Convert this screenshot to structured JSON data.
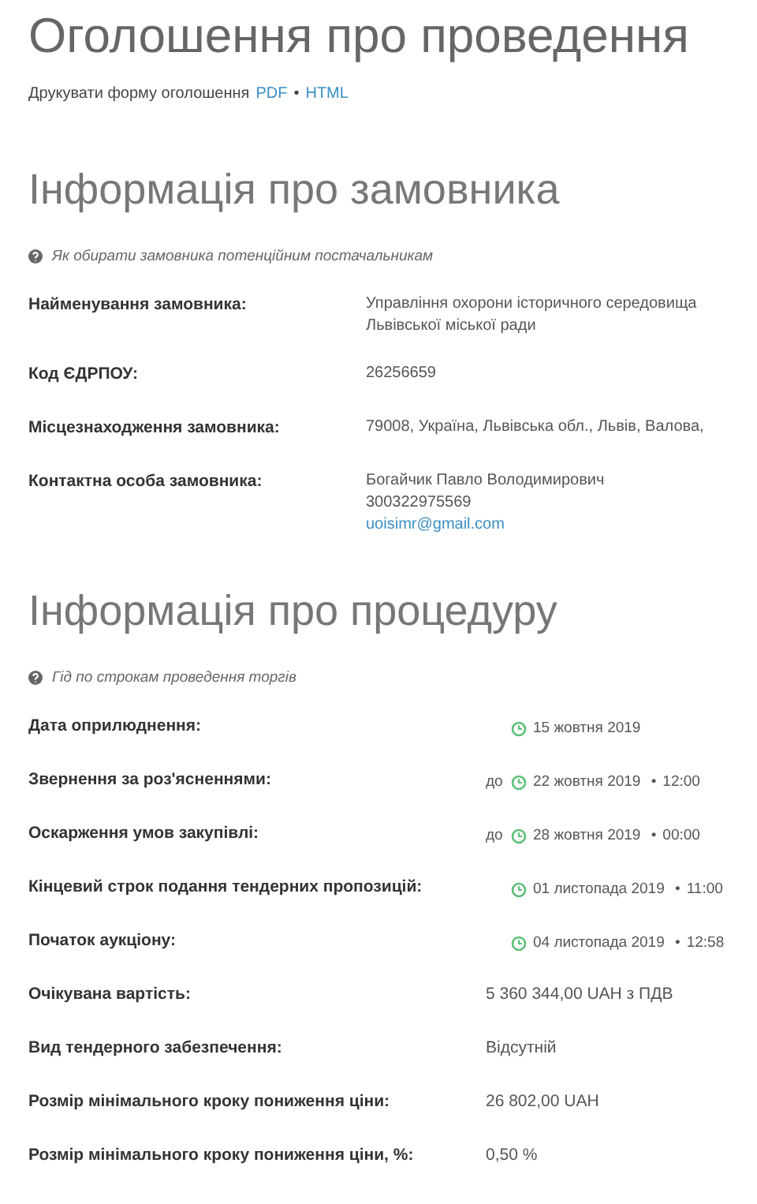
{
  "title": "Оголошення про проведення",
  "print": {
    "text": "Друкувати форму оголошення",
    "links": [
      "PDF",
      "HTML"
    ],
    "separator": "•"
  },
  "customer": {
    "heading": "Інформація про замовника",
    "hint": "Як обирати замовника потенційним постачальникам",
    "rows": [
      {
        "label": "Найменування замовника:",
        "lines": [
          "Управління охорони історичного середовища",
          "Львівської міської ради"
        ]
      },
      {
        "label": "Код ЄДРПОУ:",
        "lines": [
          "26256659"
        ]
      },
      {
        "label": "Місцезнаходження замовника:",
        "lines": [
          "79008, Україна, Львівська обл., Львів, Валова,"
        ]
      },
      {
        "label": "Контактна особа замовника:",
        "lines": [
          "Богайчик Павло Володимирович",
          "300322975569"
        ],
        "email": "uoisimr@gmail.com"
      }
    ]
  },
  "procedure": {
    "heading": "Інформація про процедуру",
    "hint": "Гід по строкам проведення торгів",
    "time_separator": "•",
    "rows": [
      {
        "kind": "date",
        "label": "Дата оприлюднення:",
        "date": "15 жовтня 2019"
      },
      {
        "kind": "date",
        "label": "Звернення за роз'ясненнями:",
        "prefix": "до",
        "date": "22 жовтня 2019",
        "time": "12:00"
      },
      {
        "kind": "date",
        "label": "Оскарження умов закупівлі:",
        "prefix": "до",
        "date": "28 жовтня 2019",
        "time": "00:00"
      },
      {
        "kind": "date",
        "label": "Кінцевий строк подання тендерних пропозицій:",
        "date": "01 листопада 2019",
        "time": "11:00"
      },
      {
        "kind": "date",
        "label": "Початок аукціону:",
        "date": "04 листопада 2019",
        "time": "12:58"
      },
      {
        "kind": "text",
        "label": "Очікувана вартість:",
        "value": "5 360 344,00 UAH з ПДВ"
      },
      {
        "kind": "text",
        "label": "Вид тендерного забезпечення:",
        "value": "Відсутній"
      },
      {
        "kind": "text",
        "label": "Розмір мінімального кроку пониження ціни:",
        "value": "26 802,00 UAH"
      },
      {
        "kind": "text",
        "label": "Розмір мінімального кроку пониження ціни, %:",
        "value": "0,50 %"
      }
    ]
  }
}
